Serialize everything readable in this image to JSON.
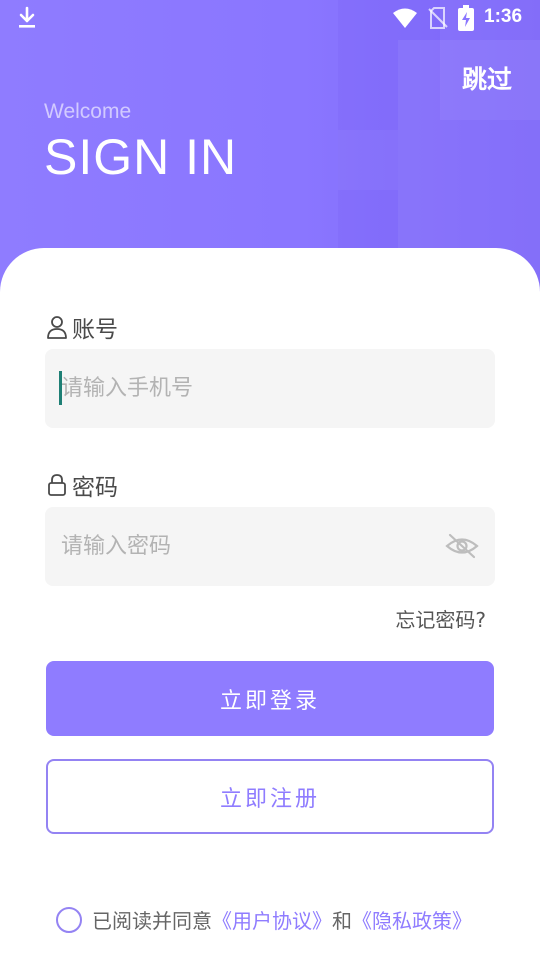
{
  "status_bar": {
    "time": "1:36",
    "icons": [
      "download-icon",
      "wifi-icon",
      "no-sim-icon",
      "battery-charging-icon"
    ]
  },
  "header": {
    "skip_label": "跳过",
    "welcome": "Welcome",
    "title": "SIGN IN"
  },
  "form": {
    "account_label": "账号",
    "account_placeholder": "请输入手机号",
    "account_value": "",
    "password_label": "密码",
    "password_placeholder": "请输入密码",
    "password_value": "",
    "forgot_label": "忘记密码?"
  },
  "buttons": {
    "login_label": "立即登录",
    "register_label": "立即注册"
  },
  "agreement": {
    "prefix": "已阅读并同意",
    "user_agreement": "《用户协议》",
    "connector": "和",
    "privacy_policy": "《隐私政策》"
  },
  "colors": {
    "accent": "#8f7cff",
    "input_bg": "#f5f5f5",
    "caret": "#1e7f75"
  }
}
